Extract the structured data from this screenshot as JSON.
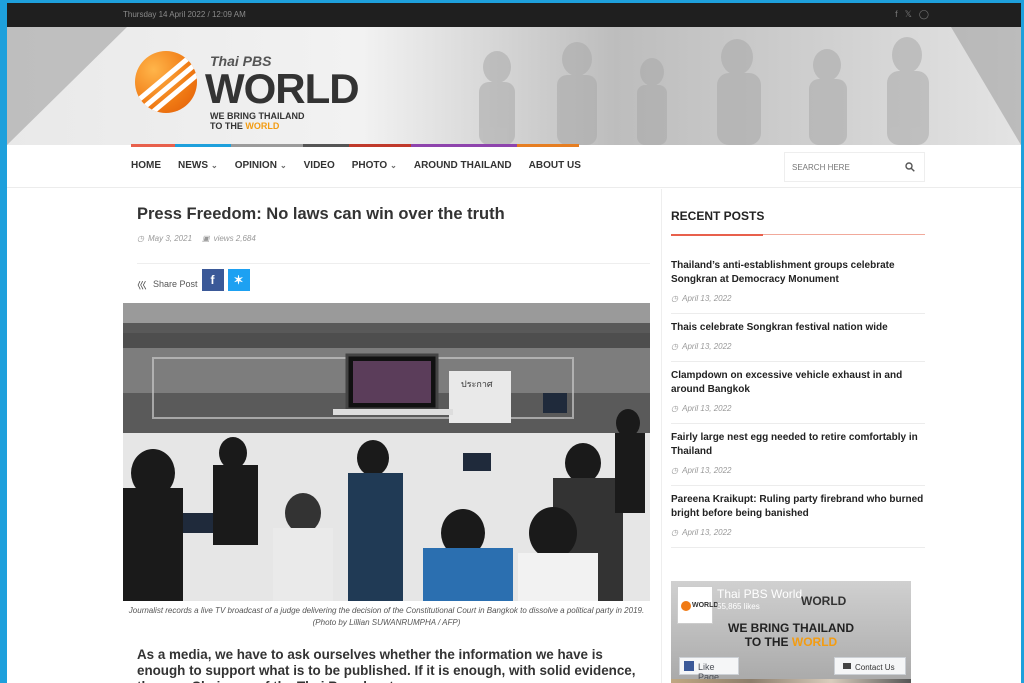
{
  "topbar": {
    "date": "Thursday 14 April 2022 / 12:09 AM"
  },
  "logo": {
    "thai": "Thai PBS",
    "world": "WORLD",
    "tagline_1": "WE BRING THAILAND",
    "tagline_2_prefix": "TO THE",
    "tagline_2_accent": "WORLD"
  },
  "nav": {
    "items": [
      {
        "label": "HOME"
      },
      {
        "label": "NEWS",
        "dropdown": true
      },
      {
        "label": "OPINION",
        "dropdown": true
      },
      {
        "label": "VIDEO"
      },
      {
        "label": "PHOTO",
        "dropdown": true
      },
      {
        "label": "AROUND THAILAND"
      },
      {
        "label": "ABOUT US"
      }
    ],
    "accent_colors": [
      "#e8604c",
      "#1ea0dc",
      "#9b9b9b",
      "#8e44ad",
      "#c0392b",
      "#e67e22",
      "#555555"
    ],
    "search_placeholder": "SEARCH HERE"
  },
  "article": {
    "title": "Press Freedom: No laws can win over the truth",
    "date": "May 3, 2021",
    "views": "views 2,684",
    "share_label": "Share Post",
    "photo_sign": "ประกาศ",
    "caption": "Journalist records a live TV broadcast of a judge delivering the decision of the Constitutional Court in Bangkok to dissolve a political party in 2019. (Photo by Lillian SUWANRUMPHA / AFP)",
    "body": "As a media, we have to ask ourselves whether the information we have is enough to support what is to be published. If it is enough, with solid evidence, then... a Chairman of the Thai Broadcast..."
  },
  "sidebar": {
    "recent_title": "RECENT POSTS",
    "posts": [
      {
        "title": "Thailand’s anti-establishment groups celebrate Songkran at Democracy Monument",
        "date": "April 13, 2022"
      },
      {
        "title": "Thais celebrate Songkran festival nation wide",
        "date": "April 13, 2022"
      },
      {
        "title": "Clampdown on excessive vehicle exhaust in and around Bangkok",
        "date": "April 13, 2022"
      },
      {
        "title": "Fairly large nest egg needed to retire comfortably in Thailand",
        "date": "April 13, 2022"
      },
      {
        "title": "Pareena Kraikupt: Ruling party firebrand who burned bright before being banished",
        "date": "April 13, 2022"
      }
    ],
    "fb": {
      "page_name": "Thai PBS World",
      "likes": "55,865 likes",
      "mini_logo": "WORLD",
      "cover_logo": "WORLD",
      "cover_tag_1": "WE BRING THAILAND",
      "cover_tag_2_prefix": "TO THE",
      "cover_tag_2_accent": "WORLD",
      "like_button": "Like Page",
      "contact_button": "Contact Us"
    }
  }
}
